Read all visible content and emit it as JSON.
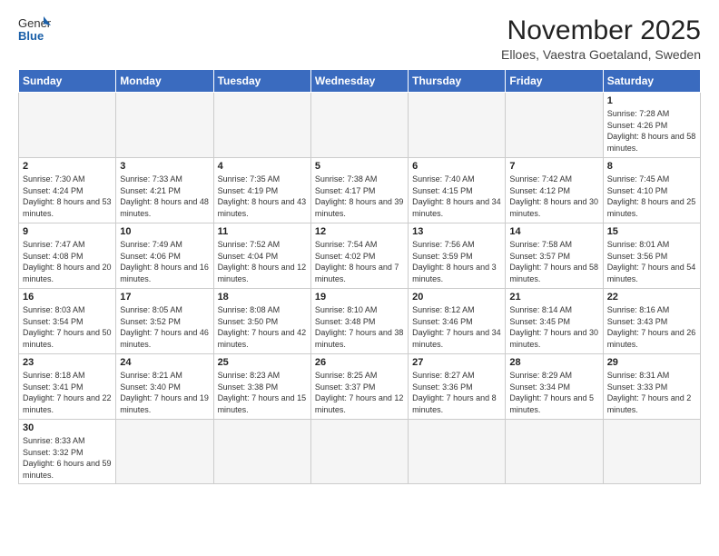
{
  "header": {
    "logo_general": "General",
    "logo_blue": "Blue",
    "main_title": "November 2025",
    "subtitle": "Elloes, Vaestra Goetaland, Sweden"
  },
  "days_of_week": [
    "Sunday",
    "Monday",
    "Tuesday",
    "Wednesday",
    "Thursday",
    "Friday",
    "Saturday"
  ],
  "weeks": [
    [
      {
        "day": "",
        "info": ""
      },
      {
        "day": "",
        "info": ""
      },
      {
        "day": "",
        "info": ""
      },
      {
        "day": "",
        "info": ""
      },
      {
        "day": "",
        "info": ""
      },
      {
        "day": "",
        "info": ""
      },
      {
        "day": "1",
        "info": "Sunrise: 7:28 AM\nSunset: 4:26 PM\nDaylight: 8 hours and 58 minutes."
      }
    ],
    [
      {
        "day": "2",
        "info": "Sunrise: 7:30 AM\nSunset: 4:24 PM\nDaylight: 8 hours and 53 minutes."
      },
      {
        "day": "3",
        "info": "Sunrise: 7:33 AM\nSunset: 4:21 PM\nDaylight: 8 hours and 48 minutes."
      },
      {
        "day": "4",
        "info": "Sunrise: 7:35 AM\nSunset: 4:19 PM\nDaylight: 8 hours and 43 minutes."
      },
      {
        "day": "5",
        "info": "Sunrise: 7:38 AM\nSunset: 4:17 PM\nDaylight: 8 hours and 39 minutes."
      },
      {
        "day": "6",
        "info": "Sunrise: 7:40 AM\nSunset: 4:15 PM\nDaylight: 8 hours and 34 minutes."
      },
      {
        "day": "7",
        "info": "Sunrise: 7:42 AM\nSunset: 4:12 PM\nDaylight: 8 hours and 30 minutes."
      },
      {
        "day": "8",
        "info": "Sunrise: 7:45 AM\nSunset: 4:10 PM\nDaylight: 8 hours and 25 minutes."
      }
    ],
    [
      {
        "day": "9",
        "info": "Sunrise: 7:47 AM\nSunset: 4:08 PM\nDaylight: 8 hours and 20 minutes."
      },
      {
        "day": "10",
        "info": "Sunrise: 7:49 AM\nSunset: 4:06 PM\nDaylight: 8 hours and 16 minutes."
      },
      {
        "day": "11",
        "info": "Sunrise: 7:52 AM\nSunset: 4:04 PM\nDaylight: 8 hours and 12 minutes."
      },
      {
        "day": "12",
        "info": "Sunrise: 7:54 AM\nSunset: 4:02 PM\nDaylight: 8 hours and 7 minutes."
      },
      {
        "day": "13",
        "info": "Sunrise: 7:56 AM\nSunset: 3:59 PM\nDaylight: 8 hours and 3 minutes."
      },
      {
        "day": "14",
        "info": "Sunrise: 7:58 AM\nSunset: 3:57 PM\nDaylight: 7 hours and 58 minutes."
      },
      {
        "day": "15",
        "info": "Sunrise: 8:01 AM\nSunset: 3:56 PM\nDaylight: 7 hours and 54 minutes."
      }
    ],
    [
      {
        "day": "16",
        "info": "Sunrise: 8:03 AM\nSunset: 3:54 PM\nDaylight: 7 hours and 50 minutes."
      },
      {
        "day": "17",
        "info": "Sunrise: 8:05 AM\nSunset: 3:52 PM\nDaylight: 7 hours and 46 minutes."
      },
      {
        "day": "18",
        "info": "Sunrise: 8:08 AM\nSunset: 3:50 PM\nDaylight: 7 hours and 42 minutes."
      },
      {
        "day": "19",
        "info": "Sunrise: 8:10 AM\nSunset: 3:48 PM\nDaylight: 7 hours and 38 minutes."
      },
      {
        "day": "20",
        "info": "Sunrise: 8:12 AM\nSunset: 3:46 PM\nDaylight: 7 hours and 34 minutes."
      },
      {
        "day": "21",
        "info": "Sunrise: 8:14 AM\nSunset: 3:45 PM\nDaylight: 7 hours and 30 minutes."
      },
      {
        "day": "22",
        "info": "Sunrise: 8:16 AM\nSunset: 3:43 PM\nDaylight: 7 hours and 26 minutes."
      }
    ],
    [
      {
        "day": "23",
        "info": "Sunrise: 8:18 AM\nSunset: 3:41 PM\nDaylight: 7 hours and 22 minutes."
      },
      {
        "day": "24",
        "info": "Sunrise: 8:21 AM\nSunset: 3:40 PM\nDaylight: 7 hours and 19 minutes."
      },
      {
        "day": "25",
        "info": "Sunrise: 8:23 AM\nSunset: 3:38 PM\nDaylight: 7 hours and 15 minutes."
      },
      {
        "day": "26",
        "info": "Sunrise: 8:25 AM\nSunset: 3:37 PM\nDaylight: 7 hours and 12 minutes."
      },
      {
        "day": "27",
        "info": "Sunrise: 8:27 AM\nSunset: 3:36 PM\nDaylight: 7 hours and 8 minutes."
      },
      {
        "day": "28",
        "info": "Sunrise: 8:29 AM\nSunset: 3:34 PM\nDaylight: 7 hours and 5 minutes."
      },
      {
        "day": "29",
        "info": "Sunrise: 8:31 AM\nSunset: 3:33 PM\nDaylight: 7 hours and 2 minutes."
      }
    ],
    [
      {
        "day": "30",
        "info": "Sunrise: 8:33 AM\nSunset: 3:32 PM\nDaylight: 6 hours and 59 minutes."
      },
      {
        "day": "",
        "info": ""
      },
      {
        "day": "",
        "info": ""
      },
      {
        "day": "",
        "info": ""
      },
      {
        "day": "",
        "info": ""
      },
      {
        "day": "",
        "info": ""
      },
      {
        "day": "",
        "info": ""
      }
    ]
  ]
}
